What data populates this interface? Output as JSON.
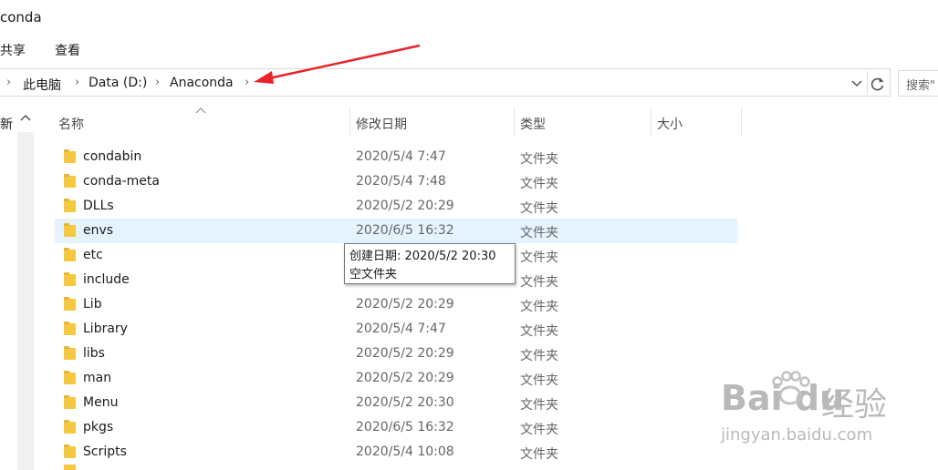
{
  "window": {
    "title": "conda"
  },
  "ribbon": {
    "share": "共享",
    "view": "查看"
  },
  "address": {
    "crumbs": [
      "此电脑",
      "Data (D:)",
      "Anaconda"
    ],
    "search_placeholder": "搜索\"",
    "arrow_color": "#e8232a"
  },
  "nav": {
    "label": "新"
  },
  "columns": {
    "name": "名称",
    "date": "修改日期",
    "type": "类型",
    "size": "大小"
  },
  "rows": [
    {
      "name": "condabin",
      "date": "2020/5/4 7:47",
      "type": "文件夹"
    },
    {
      "name": "conda-meta",
      "date": "2020/5/4 7:48",
      "type": "文件夹"
    },
    {
      "name": "DLLs",
      "date": "2020/5/2 20:29",
      "type": "文件夹"
    },
    {
      "name": "envs",
      "date": "2020/6/5 16:32",
      "type": "文件夹"
    },
    {
      "name": "etc",
      "date": "",
      "type": "文件夹"
    },
    {
      "name": "include",
      "date": "",
      "type": "文件夹"
    },
    {
      "name": "Lib",
      "date": "2020/5/2 20:29",
      "type": "文件夹"
    },
    {
      "name": "Library",
      "date": "2020/5/4 7:47",
      "type": "文件夹"
    },
    {
      "name": "libs",
      "date": "2020/5/2 20:29",
      "type": "文件夹"
    },
    {
      "name": "man",
      "date": "2020/5/2 20:29",
      "type": "文件夹"
    },
    {
      "name": "Menu",
      "date": "2020/5/2 20:30",
      "type": "文件夹"
    },
    {
      "name": "pkgs",
      "date": "2020/6/5 16:32",
      "type": "文件夹"
    },
    {
      "name": "Scripts",
      "date": "2020/5/4 10:08",
      "type": "文件夹"
    }
  ],
  "tooltip": {
    "line1": "创建日期: 2020/5/2 20:30",
    "line2": "空文件夹"
  },
  "watermark": {
    "brand": "Bai du",
    "sub": "经验",
    "url": "jingyan.baidu.com"
  }
}
